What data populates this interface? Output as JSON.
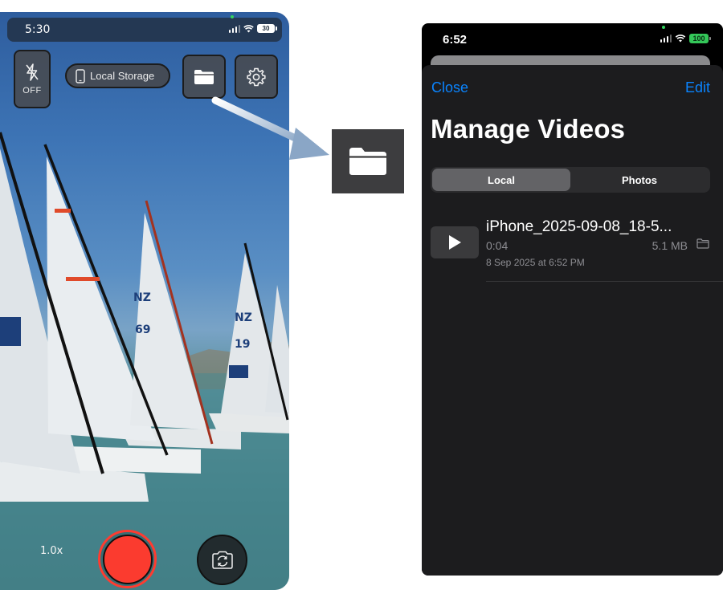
{
  "camera_screen": {
    "status_bar": {
      "time": "5:30",
      "battery": "30"
    },
    "flash": {
      "label": "OFF",
      "icon": "flash-off-icon"
    },
    "storage_selector": {
      "label": "Local Storage",
      "icon": "phone-icon"
    },
    "folder_button": {
      "icon": "folder-icon"
    },
    "settings_button": {
      "icon": "gear-icon"
    },
    "zoom": {
      "label": "1.0x"
    },
    "record_button": {
      "color": "#FB3B2F"
    },
    "flip_camera_button": {
      "icon": "camera-flip-icon"
    }
  },
  "callout": {
    "icon": "folder-icon"
  },
  "manage_videos": {
    "status_bar": {
      "time": "6:52",
      "battery": "100"
    },
    "nav": {
      "close_label": "Close",
      "edit_label": "Edit"
    },
    "title": "Manage Videos",
    "segments": [
      {
        "label": "Local",
        "active": true
      },
      {
        "label": "Photos",
        "active": false
      }
    ],
    "videos": [
      {
        "name": "iPhone_2025-09-08_18-5...",
        "duration": "0:04",
        "size": "5.1 MB",
        "date": "8 Sep 2025 at 6:52 PM"
      }
    ],
    "accent_color": "#0A84FF"
  }
}
